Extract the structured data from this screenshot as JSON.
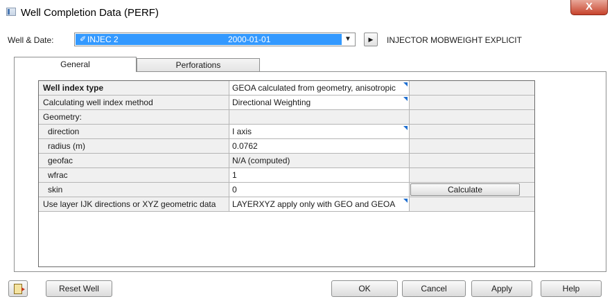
{
  "window": {
    "title": "Well Completion Data (PERF)",
    "close_label": "X"
  },
  "well_row": {
    "label": "Well & Date:",
    "selected_well": "INJEC 2",
    "selected_date": "2000-01-01",
    "well_type": "INJECTOR MOBWEIGHT EXPLICIT"
  },
  "tabs": [
    {
      "label": "General",
      "active": true
    },
    {
      "label": "Perforations",
      "active": false
    }
  ],
  "grid": {
    "rows": [
      {
        "label": "Well index type",
        "value": "GEOA calculated from geometry, anisotropic",
        "bold": true,
        "dropdown": true
      },
      {
        "label": "Calculating well index method",
        "value": "Directional Weighting",
        "dropdown": true
      },
      {
        "label": "Geometry:",
        "value": ""
      },
      {
        "label": "direction",
        "value": "I axis",
        "dropdown": true
      },
      {
        "label": "radius (m)",
        "value": "0.0762"
      },
      {
        "label": "geofac",
        "value": "N/A (computed)"
      },
      {
        "label": "wfrac",
        "value": "1"
      },
      {
        "label": "skin",
        "value": "0"
      },
      {
        "label": "Use layer IJK directions or XYZ geometric data",
        "value": "LAYERXYZ apply only with GEO and GEOA",
        "dropdown": true
      }
    ],
    "calculate_label": "Calculate"
  },
  "buttons": {
    "reset": "Reset Well",
    "ok": "OK",
    "cancel": "Cancel",
    "apply": "Apply",
    "help": "Help"
  },
  "colors": {
    "selection": "#3399ff",
    "close": "#c7432c",
    "dropdown_marker": "#1f6fd1"
  }
}
